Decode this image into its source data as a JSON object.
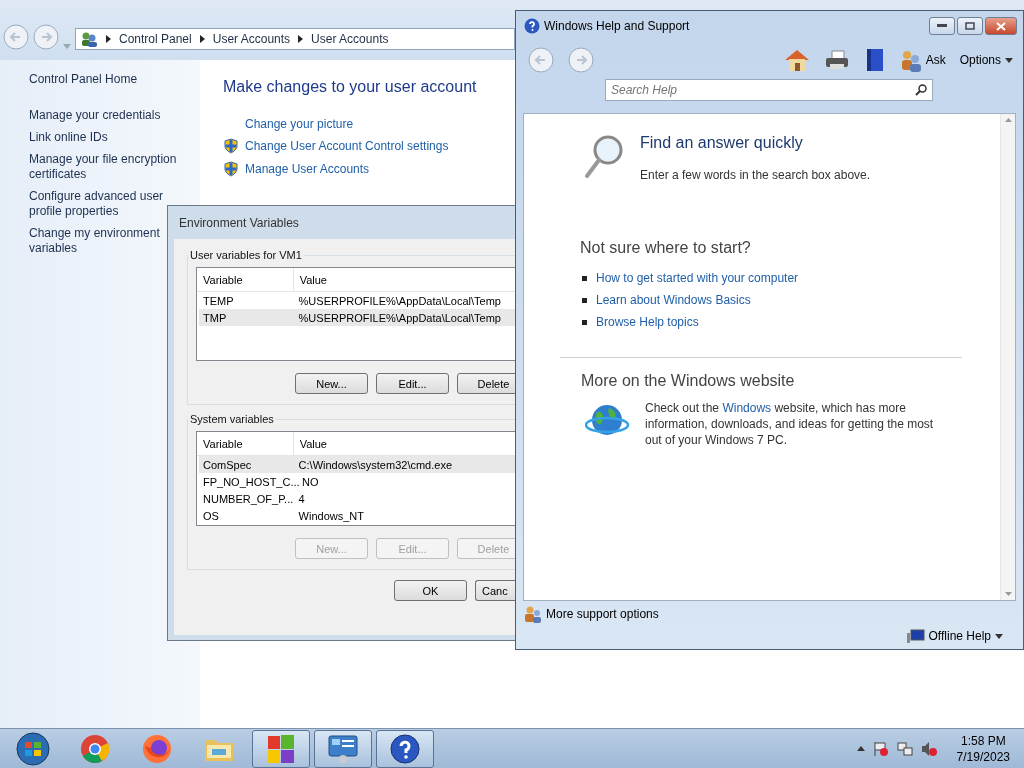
{
  "control_panel": {
    "breadcrumb": [
      "Control Panel",
      "User Accounts",
      "User Accounts"
    ],
    "sidebar": {
      "home": "Control Panel Home",
      "links": [
        "Manage your credentials",
        "Link online IDs",
        "Manage your file encryption certificates",
        "Configure advanced user profile properties",
        "Change my environment variables"
      ]
    },
    "heading": "Make changes to your user account",
    "tasks": [
      {
        "label": "Change your picture",
        "shield": false
      },
      {
        "label": "Change User Account Control settings",
        "shield": true
      },
      {
        "label": "Manage User Accounts",
        "shield": true
      }
    ]
  },
  "env_dialog": {
    "title": "Environment Variables",
    "groups": [
      {
        "title": "User variables for VM1",
        "columns": [
          "Variable",
          "Value"
        ],
        "rows": [
          {
            "cells": [
              "TEMP",
              "%USERPROFILE%\\AppData\\Local\\Temp"
            ],
            "selected": false
          },
          {
            "cells": [
              "TMP",
              "%USERPROFILE%\\AppData\\Local\\Temp"
            ],
            "selected": true
          }
        ],
        "buttons": [
          {
            "label": "New...",
            "disabled": false
          },
          {
            "label": "Edit...",
            "disabled": false
          },
          {
            "label": "Delete",
            "disabled": false
          }
        ]
      },
      {
        "title": "System variables",
        "columns": [
          "Variable",
          "Value"
        ],
        "rows": [
          {
            "cells": [
              "ComSpec",
              "C:\\Windows\\system32\\cmd.exe"
            ],
            "selected": true
          },
          {
            "cells": [
              "FP_NO_HOST_C...",
              "NO"
            ],
            "selected": false
          },
          {
            "cells": [
              "NUMBER_OF_P...",
              "4"
            ],
            "selected": false
          },
          {
            "cells": [
              "OS",
              "Windows_NT"
            ],
            "selected": false
          }
        ],
        "buttons": [
          {
            "label": "New...",
            "disabled": true
          },
          {
            "label": "Edit...",
            "disabled": true
          },
          {
            "label": "Delete",
            "disabled": true
          }
        ]
      }
    ],
    "buttons": [
      "OK",
      "Canc"
    ]
  },
  "help_window": {
    "title": "Windows Help and Support",
    "toolbar": {
      "ask": "Ask",
      "options": "Options"
    },
    "search": {
      "placeholder": "Search Help"
    },
    "find": {
      "heading": "Find an answer quickly",
      "text": "Enter a few words in the search box above."
    },
    "start": {
      "heading": "Not sure where to start?",
      "links": [
        "How to get started with your computer",
        "Learn about Windows Basics",
        "Browse Help topics"
      ]
    },
    "website": {
      "heading": "More on the Windows website",
      "before": "Check out the ",
      "link": "Windows",
      "after": " website, which has more information, downloads, and ideas for getting the most out of your Windows 7 PC."
    },
    "footer": {
      "support": "More support options",
      "offline": "Offline Help"
    }
  },
  "taskbar": {
    "apps": [
      {
        "kind": "start",
        "running": false
      },
      {
        "kind": "chrome",
        "running": false
      },
      {
        "kind": "firefox",
        "running": false
      },
      {
        "kind": "folder",
        "running": false
      },
      {
        "kind": "windows",
        "running": true
      },
      {
        "kind": "control-panel",
        "running": true
      },
      {
        "kind": "help",
        "running": true
      }
    ],
    "time": "1:58 PM",
    "date": "7/19/2023"
  }
}
